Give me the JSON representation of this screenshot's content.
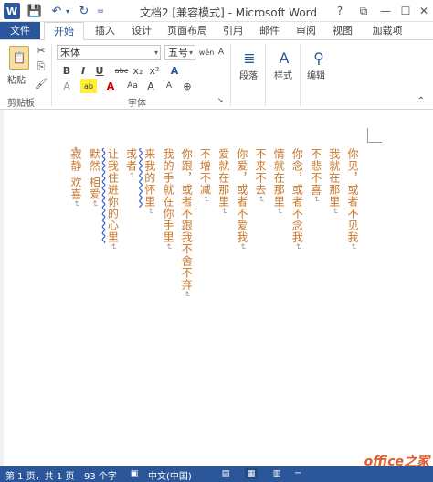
{
  "window": {
    "title": "文档2 [兼容模式] - Microsoft Word",
    "logo_letter": "W",
    "controls": {
      "help": "?",
      "ribbon_options": "⧉",
      "minimize": "—",
      "maximize": "☐",
      "close": "✕"
    }
  },
  "quick_access": {
    "save": "💾",
    "undo": "↶",
    "undo_dropdown": "▾",
    "redo": "↻",
    "more": "="
  },
  "tabs": [
    "文件",
    "开始",
    "插入",
    "设计",
    "页面布局",
    "引用",
    "邮件",
    "审阅",
    "视图",
    "加载项"
  ],
  "ribbon": {
    "clipboard": {
      "label": "剪贴板",
      "paste": "粘贴",
      "cut": "✂",
      "copy": "⎘",
      "format_painter": "🖌"
    },
    "font": {
      "label": "字体",
      "name": "宋体",
      "size": "五号",
      "wen": "wén",
      "row2": [
        "B",
        "I",
        "U",
        "abc",
        "x₂",
        "x²",
        "A"
      ],
      "row3": [
        "A",
        "ab",
        "A",
        "Aa",
        "A",
        "A",
        "⊕"
      ]
    },
    "paragraph": {
      "label": "段落"
    },
    "styles": {
      "label": "样式"
    },
    "editing": {
      "label": "编辑"
    }
  },
  "document": {
    "columns": [
      {
        "text": "你见，或者不见我",
        "squiggly": false
      },
      {
        "text": "我就在那里",
        "squiggly": false
      },
      {
        "text": "不悲不喜",
        "squiggly": false
      },
      {
        "text": "你念，或者不念我",
        "squiggly": false
      },
      {
        "text": "情就在那里",
        "squiggly": false
      },
      {
        "text": "不来不去",
        "squiggly": false
      },
      {
        "text": "你爱，或者不爱我",
        "squiggly": false
      },
      {
        "text": "爱就在那里",
        "squiggly": false
      },
      {
        "text": "不增不减",
        "squiggly": false
      },
      {
        "text": "你跟，或者不跟我不舍不弃",
        "squiggly": false
      },
      {
        "text": "我的手就在你手里",
        "squiggly": false
      },
      {
        "text": "来我的怀里",
        "squiggly": true
      },
      {
        "text": "或者",
        "squiggly": false
      },
      {
        "text": "让我住进你的心里",
        "squiggly": true
      },
      {
        "text": "默然 相爱",
        "squiggly": false
      },
      {
        "text": "寂静 欢喜",
        "squiggly": false
      }
    ],
    "paragraph_mark": "↵"
  },
  "status": {
    "page": "第 1 页，共 1 页",
    "words": "93 个字",
    "lang": "中文(中国)",
    "accent": "#2b579a"
  },
  "watermark": "office之家"
}
